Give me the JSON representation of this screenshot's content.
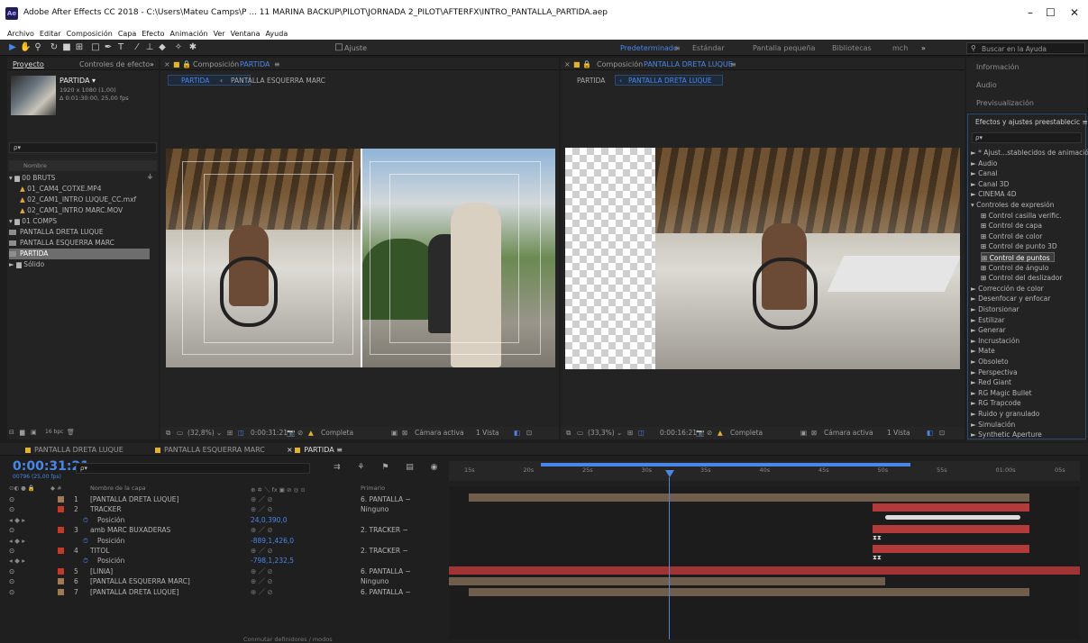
{
  "window": {
    "title": "Adobe After Effects CC 2018 - C:\\Users\\Mateu Camps\\P ... 11 MARINA BACKUP\\PILOT\\JORNADA 2_PILOT\\AFTERFX\\INTRO_PANTALLA_PARTIDA.aep",
    "app_icon": "Ae",
    "minimize": "–",
    "maximize": "☐",
    "close": "✕"
  },
  "menu": [
    "Archivo",
    "Editar",
    "Composición",
    "Capa",
    "Efecto",
    "Animación",
    "Ver",
    "Ventana",
    "Ayuda"
  ],
  "toolbar": {
    "ajuste": "Ajuste",
    "workspaces": [
      "Predeterminado",
      "≡",
      "Estándar",
      "Pantalla pequeña",
      "Bibliotecas",
      "mch",
      "»"
    ],
    "search_placeholder": "Buscar en la Ayuda"
  },
  "project": {
    "tab_active": "Proyecto",
    "tab_other": "Controles de efecto",
    "overflow": "»",
    "item_name": "PARTIDA ▾",
    "item_size": "1920 x 1080 (1,00)",
    "item_duration": "Δ 0:01:30:00, 25,00 fps",
    "search_icon": "ρ▾",
    "col_name": "Nombre",
    "items": [
      {
        "label": "▾ ▆ 00 BRUTS",
        "kind": "folder"
      },
      {
        "label": "01_CAM4_COTXE.MP4",
        "kind": "footage"
      },
      {
        "label": "02_CAM1_INTRO LUQUE_CC.mxf",
        "kind": "footage"
      },
      {
        "label": "02_CAM1_INTRO MARC.MOV",
        "kind": "footage"
      },
      {
        "label": "▾ ▆ 01 COMPS",
        "kind": "folder"
      },
      {
        "label": "PANTALLA DRETA LUQUE",
        "kind": "comp"
      },
      {
        "label": "PANTALLA ESQUERRA MARC",
        "kind": "comp"
      },
      {
        "label": "PARTIDA",
        "kind": "comp",
        "selected": true
      },
      {
        "label": "► ▆ Sólido",
        "kind": "folder"
      }
    ],
    "bpc": "16 bpc"
  },
  "comp_left": {
    "tab_prefix": "Composición",
    "tab_name": "PARTIDA",
    "breadcrumb_active": "PARTIDA",
    "breadcrumb_sep": "‹",
    "breadcrumb_next": "PANTALLA ESQUERRA MARC",
    "zoom": "(32,8%)",
    "timecode": "0:00:31:21",
    "quality": "Completa",
    "camera": "Cámara activa",
    "views": "1 Vista"
  },
  "comp_right": {
    "tab_prefix": "Composición",
    "tab_name": "PANTALLA DRETA LUQUE",
    "breadcrumb_prev": "PARTIDA",
    "breadcrumb_sep": "‹",
    "breadcrumb_active": "PANTALLA DRETA LUQUE",
    "zoom": "(33,3%)",
    "timecode": "0:00:16:21",
    "quality": "Completa",
    "camera": "Cámara activa",
    "views": "1 Vista"
  },
  "right_panels": [
    "Información",
    "Audio",
    "Previsualización"
  ],
  "effects": {
    "title": "Efectos y ajustes preestablecic ≡",
    "search_icon": "ρ▾",
    "items": [
      {
        "label": "► * Ajust...stablecidos de animación",
        "sub": false
      },
      {
        "label": "► Audio",
        "sub": false
      },
      {
        "label": "► Canal",
        "sub": false
      },
      {
        "label": "► Canal 3D",
        "sub": false
      },
      {
        "label": "► CINEMA 4D",
        "sub": false
      },
      {
        "label": "▾ Controles de expresión",
        "sub": false
      },
      {
        "label": "Control casilla verific.",
        "sub": true
      },
      {
        "label": "Control de capa",
        "sub": true
      },
      {
        "label": "Control de color",
        "sub": true
      },
      {
        "label": "Control de punto 3D",
        "sub": true
      },
      {
        "label": "Control de puntos",
        "sub": true,
        "selected": true
      },
      {
        "label": "Control de ángulo",
        "sub": true
      },
      {
        "label": "Control del deslizador",
        "sub": true
      },
      {
        "label": "► Corrección de color",
        "sub": false
      },
      {
        "label": "► Desenfocar y enfocar",
        "sub": false
      },
      {
        "label": "► Distorsionar",
        "sub": false
      },
      {
        "label": "► Estilizar",
        "sub": false
      },
      {
        "label": "► Generar",
        "sub": false
      },
      {
        "label": "► Incrustación",
        "sub": false
      },
      {
        "label": "► Mate",
        "sub": false
      },
      {
        "label": "► Obsoleto",
        "sub": false
      },
      {
        "label": "► Perspectiva",
        "sub": false
      },
      {
        "label": "► Red Giant",
        "sub": false
      },
      {
        "label": "► RG Magic Bullet",
        "sub": false
      },
      {
        "label": "► RG Trapcode",
        "sub": false
      },
      {
        "label": "► Ruido y granulado",
        "sub": false
      },
      {
        "label": "► Simulación",
        "sub": false
      },
      {
        "label": "► Synthetic Aperture",
        "sub": false
      }
    ]
  },
  "timeline": {
    "tabs": [
      "PANTALLA DRETA LUQUE",
      "PANTALLA ESQUERRA MARC",
      "PARTIDA"
    ],
    "timecode": "0:00:31:21",
    "frame_info": "00796 (25,00 fps)",
    "search_icon": "ρ▾",
    "col_layer": "Nombre de la capa",
    "col_parent": "Primario",
    "col_switches": "⊕ ✲ ＼ fx ▣ ⊘ ◎ ⊙",
    "rows": [
      {
        "num": "1",
        "name": "[PANTALLA DRETA LUQUE]",
        "parent": "6. PANTALLA ~",
        "color": "#9e7b54"
      },
      {
        "num": "2",
        "name": "TRACKER",
        "parent": "Ninguno",
        "color": "#c0392b"
      },
      {
        "num": "",
        "name": "Posición",
        "value": "24,0,390,0",
        "prop": true
      },
      {
        "num": "3",
        "name": "amb MARC BUXADERAS",
        "parent": "2. TRACKER ~",
        "color": "#c0392b"
      },
      {
        "num": "",
        "name": "Posición",
        "value": "-889,1,426,0",
        "prop": true
      },
      {
        "num": "4",
        "name": "TITOL",
        "parent": "2. TRACKER ~",
        "color": "#c0392b"
      },
      {
        "num": "",
        "name": "Posición",
        "value": "-798,1,232,5",
        "prop": true
      },
      {
        "num": "5",
        "name": "[LINIA]",
        "parent": "6. PANTALLA ~",
        "color": "#c0392b"
      },
      {
        "num": "6",
        "name": "[PANTALLA ESQUERRA MARC]",
        "parent": "Ninguno",
        "color": "#9e7b54"
      },
      {
        "num": "7",
        "name": "[PANTALLA DRETA LUQUE]",
        "parent": "6. PANTALLA ~",
        "color": "#9e7b54"
      }
    ],
    "ruler": [
      "15s",
      "20s",
      "25s",
      "30s",
      "35s",
      "40s",
      "45s",
      "50s",
      "55s",
      "01:00s",
      "05s"
    ],
    "bottom": "Conmutar definidores / modos"
  }
}
